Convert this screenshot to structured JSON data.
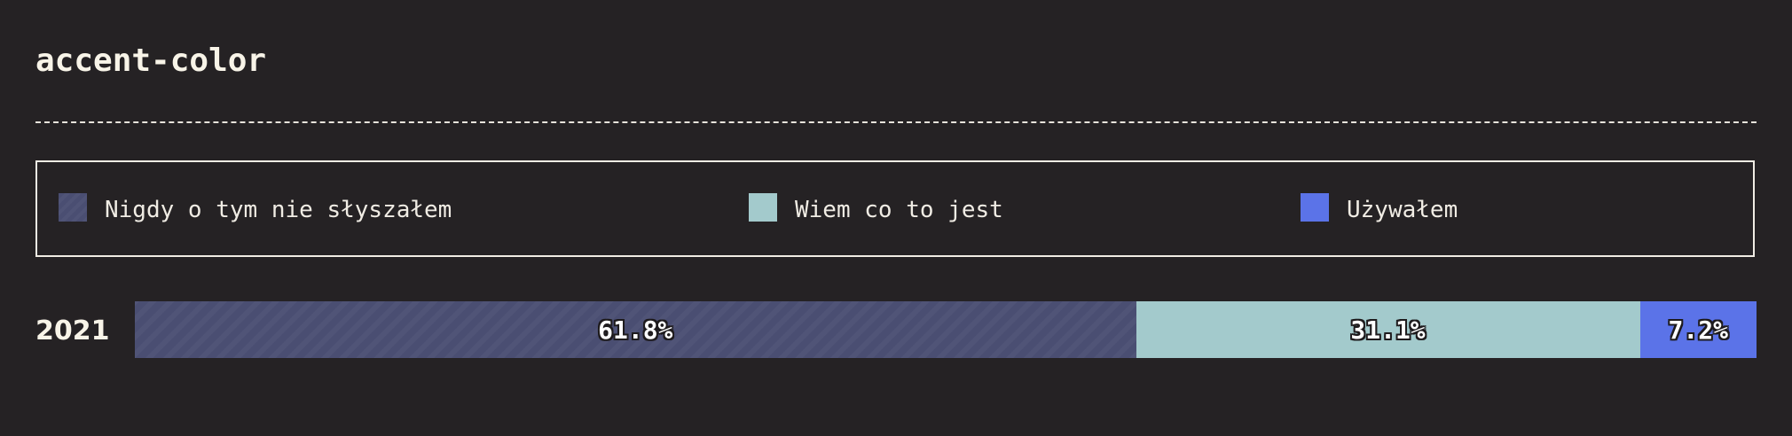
{
  "title": "accent-color",
  "colors": {
    "background": "#252224",
    "never_heard": "#4a4e72",
    "know_what": "#a3cacc",
    "used": "#5b73e8"
  },
  "legend": [
    {
      "label": "Nigdy o tym nie słyszałem",
      "color": "#4a4e72",
      "pattern": "hatched"
    },
    {
      "label": "Wiem co to jest",
      "color": "#a3cacc",
      "pattern": "solid"
    },
    {
      "label": "Używałem",
      "color": "#5b73e8",
      "pattern": "solid"
    }
  ],
  "chart_data": {
    "type": "bar",
    "orientation": "horizontal",
    "stacked": true,
    "normalized": true,
    "categories": [
      "2021"
    ],
    "series": [
      {
        "name": "Nigdy o tym nie słyszałem",
        "values": [
          61.8
        ],
        "label": "61.8%"
      },
      {
        "name": "Wiem co to jest",
        "values": [
          31.1
        ],
        "label": "31.1%"
      },
      {
        "name": "Używałem",
        "values": [
          7.2
        ],
        "label": "7.2%"
      }
    ],
    "unit": "%",
    "legend_position": "top",
    "grid": false
  }
}
